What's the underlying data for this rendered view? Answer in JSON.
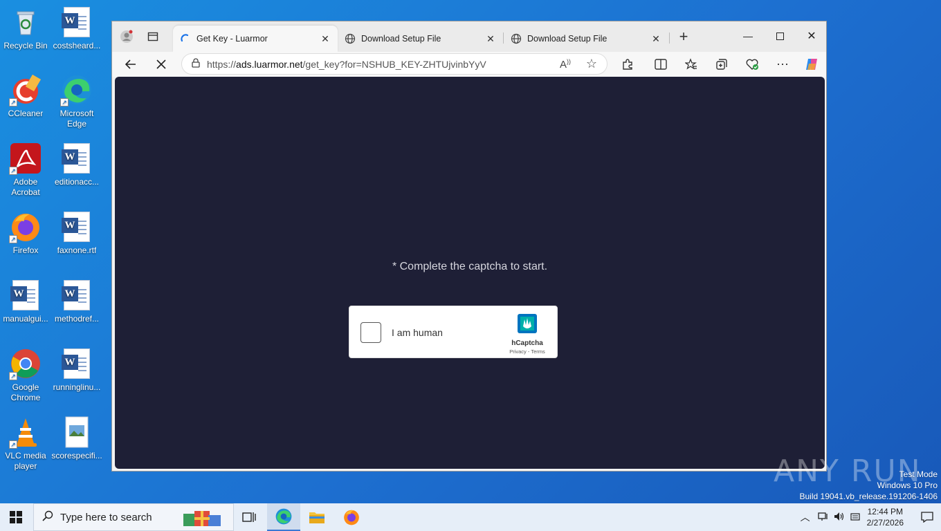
{
  "desktop": {
    "icons": [
      {
        "label": "Recycle Bin"
      },
      {
        "label": "costsheard..."
      },
      {
        "label": "CCleaner"
      },
      {
        "label": "Microsoft Edge"
      },
      {
        "label": "Adobe Acrobat"
      },
      {
        "label": "editionacc..."
      },
      {
        "label": "Firefox"
      },
      {
        "label": "faxnone.rtf"
      },
      {
        "label": "manualgui..."
      },
      {
        "label": "methodref..."
      },
      {
        "label": "Google Chrome"
      },
      {
        "label": "runninglinu..."
      },
      {
        "label": "VLC media player"
      },
      {
        "label": "scorespecifi..."
      }
    ]
  },
  "browser": {
    "tabs": [
      {
        "title": "Get Key - Luarmor",
        "active": true
      },
      {
        "title": "Download Setup File",
        "active": false
      },
      {
        "title": "Download Setup File",
        "active": false
      }
    ],
    "address": {
      "prefix": "https://",
      "host": "ads.luarmor.net",
      "path": "/get_key?for=NSHUB_KEY-ZHTUjvinbYyV"
    },
    "page": {
      "captcha_prompt": "* Complete the captcha to start.",
      "captcha_label": "I am human",
      "captcha_brand": "hCaptcha",
      "captcha_links": "Privacy - Terms"
    }
  },
  "taskbar": {
    "search_placeholder": "Type here to search",
    "time": "12:44 PM",
    "date": "2/27/2026"
  },
  "watermark": {
    "brand": "ANY RUN",
    "line1": "Test Mode",
    "line2": "Windows 10 Pro",
    "line3": "Build 19041.vb_release.191206-1406"
  },
  "colors": {
    "page_bg": "#1e1f36",
    "desktop_bg": "#1a7fd6",
    "accent": "#3a78d4"
  }
}
